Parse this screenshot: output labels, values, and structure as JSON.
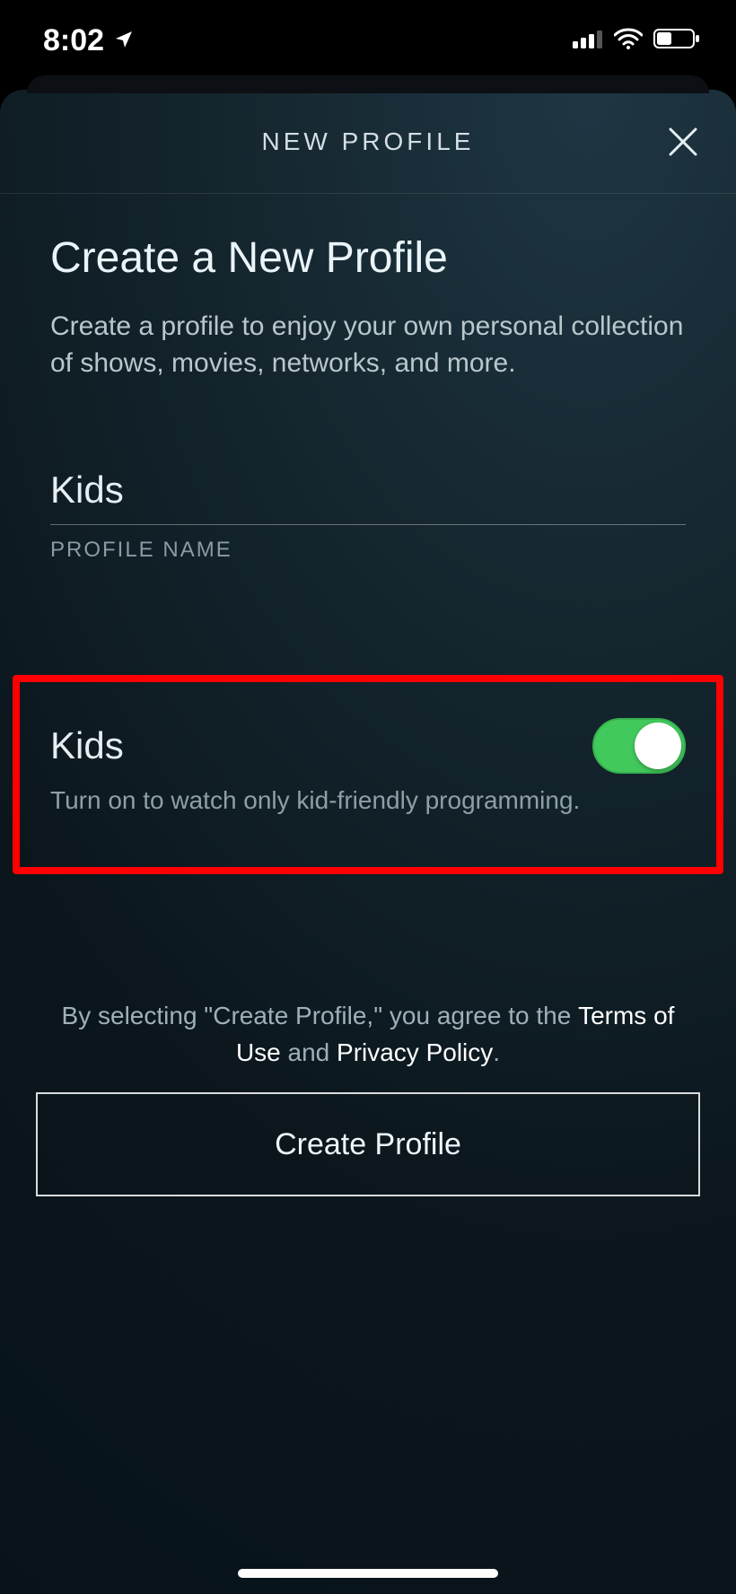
{
  "status": {
    "time": "8:02",
    "location_icon": "location-arrow-icon",
    "signal_icon": "cellular-signal-icon",
    "wifi_icon": "wifi-icon",
    "battery_icon": "battery-icon"
  },
  "header": {
    "title": "NEW PROFILE",
    "close_icon": "close-icon"
  },
  "main": {
    "heading": "Create a New Profile",
    "subheading": "Create a profile to enjoy your own personal collection of shows, movies, networks, and more.",
    "profile_name_value": "Kids",
    "profile_name_label": "PROFILE NAME"
  },
  "kids_toggle": {
    "label": "Kids",
    "description": "Turn on to watch only kid-friendly programming.",
    "state": "on",
    "colors": {
      "on_bg": "#41c95c",
      "knob": "#ffffff"
    }
  },
  "legal": {
    "prefix": "By selecting \"Create Profile,\" you agree to the ",
    "terms_label": "Terms of Use",
    "and": " and ",
    "privacy_label": "Privacy Policy",
    "suffix": "."
  },
  "cta": {
    "create_label": "Create Profile"
  },
  "annotation": {
    "highlight": "kids-toggle-section",
    "highlight_color": "#ff0000"
  }
}
